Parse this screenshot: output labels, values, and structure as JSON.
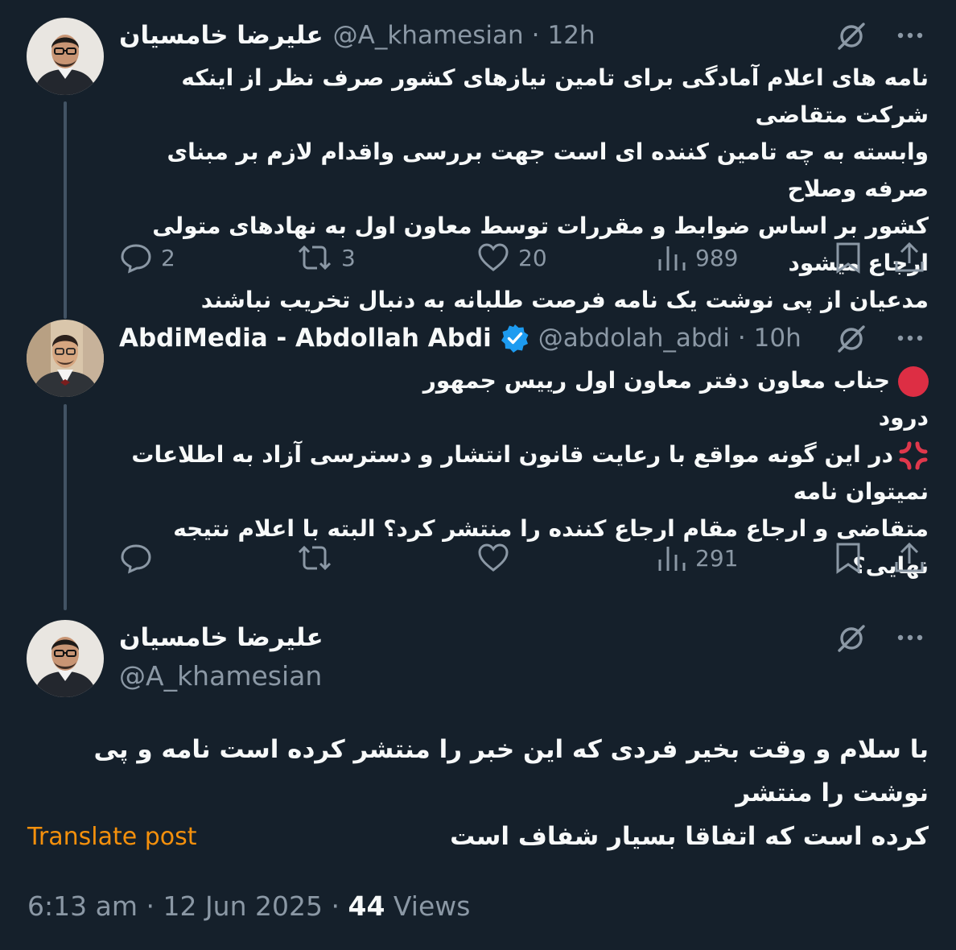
{
  "colors": {
    "background": "#15202b",
    "text": "#f7f9f9",
    "muted": "#8b98a5",
    "verified": "#1d9bf0",
    "translate_link": "#f4900c"
  },
  "tweet1": {
    "name": "علیرضا خامسیان",
    "handle": "@A_khamesian",
    "time": "12h",
    "separator": "·",
    "text_lines": [
      "نامه های اعلام آمادگی برای تامین نیازهای کشور صرف نظر از اینکه شرکت متقاضی",
      "وابسته به چه تامین کننده ای است جهت بررسی واقدام لازم بر مبنای صرفه وصلاح",
      "کشور بر اساس ضوابط و مقررات توسط معاون اول به نهادهای متولی ارجاع میشود",
      "مدعیان از پی نوشت یک نامه فرصت طلبانه به دنبال تخریب نباشند"
    ],
    "replies": "2",
    "reposts": "3",
    "likes": "20",
    "views": "989"
  },
  "tweet2": {
    "name": "AbdiMedia - Abdollah Abdi",
    "handle": "@abdolah_abdi",
    "time": "10h",
    "separator": "·",
    "line1": "جناب معاون دفتر معاون اول رییس جمهور",
    "line2": "درود",
    "line3": "در این گونه مواقع با رعایت قانون انتشار و دسترسی آزاد به اطلاعات نمیتوان نامه",
    "line4": "متقاضی و ارجاع مقام ارجاع کننده را منتشر کرد؟ البته با اعلام نتیجه نهایی؟",
    "views": "291"
  },
  "main_tweet": {
    "name": "علیرضا خامسیان",
    "handle": "@A_khamesian",
    "text_lines": [
      "با سلام و وقت بخیر فردی که این خبر را منتشر کرده است نامه و پی نوشت را منتشر",
      "کرده است که اتفاقا بسیار شفاف است"
    ],
    "translate": "Translate post",
    "time": "6:13 am",
    "date": "12 Jun 2025",
    "separator": "·",
    "views_count": "44",
    "views_label": "Views"
  },
  "icons": {
    "grok": "grok-icon",
    "more": "more-icon",
    "reply": "reply-icon",
    "repost": "repost-icon",
    "like": "like-icon",
    "views": "views-icon",
    "bookmark": "bookmark-icon",
    "share": "share-icon",
    "verified": "verified-badge-icon"
  }
}
